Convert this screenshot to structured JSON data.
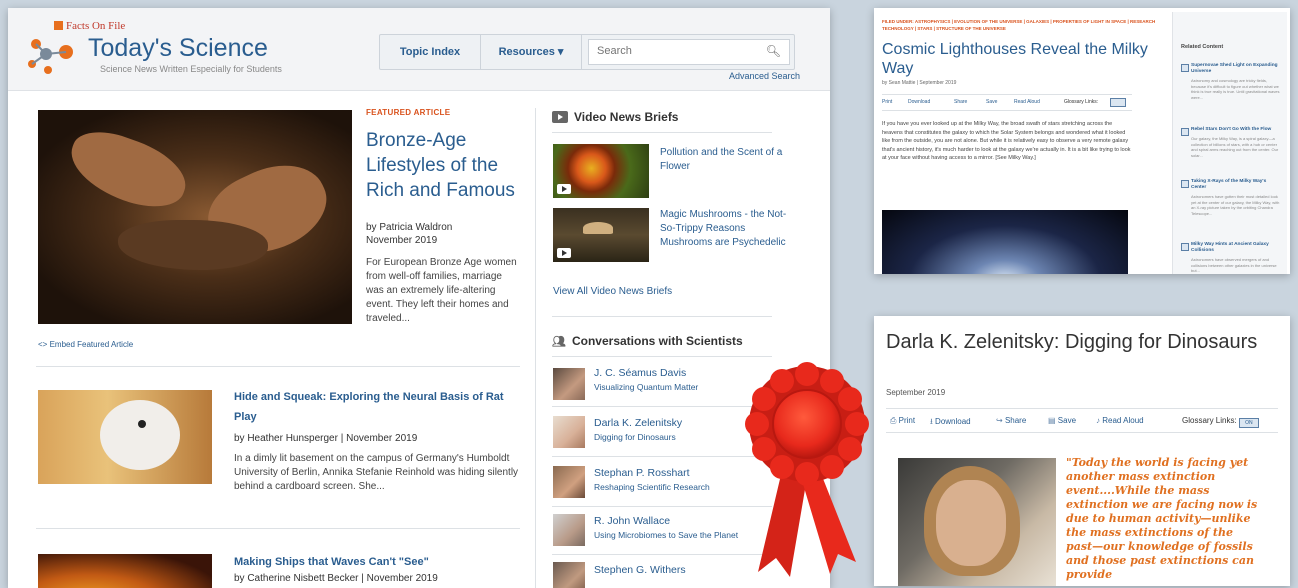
{
  "header": {
    "brand_top": "Facts On File",
    "brand_name": "Today's Science",
    "tagline": "Science News Written Especially for Students",
    "nav": [
      "Topic Index",
      "Resources ▾"
    ],
    "search_placeholder": "Search",
    "advanced_search": "Advanced Search"
  },
  "featured": {
    "label": "FEATURED ARTICLE",
    "title": "Bronze-Age Lifestyles of the Rich and Famous",
    "author": "by Patricia Waldron",
    "date": "November 2019",
    "excerpt": "For European Bronze Age women from well-off families, marriage was an extremely life-altering event. They left their homes and traveled...",
    "embed": "<> Embed Featured Article"
  },
  "articles": [
    {
      "title": "Hide and Squeak: Exploring the Neural Basis of Rat Play",
      "byline": "by Heather Hunsperger | November 2019",
      "excerpt": "In a dimly lit basement on the campus of Germany's Humboldt University of Berlin, Annika Stefanie Reinhold was hiding silently behind a cardboard screen. She..."
    },
    {
      "title": "Making Ships that Waves Can't \"See\"",
      "byline": "by Catherine Nisbett Becker | November 2019"
    }
  ],
  "video_briefs": {
    "heading": "Video News Briefs",
    "items": [
      "Pollution and the Scent of a Flower",
      "Magic Mushrooms - the Not-So-Trippy Reasons Mushrooms are Psychedelic"
    ],
    "view_all": "View All Video News Briefs"
  },
  "conversations": {
    "heading": "Conversations with Scientists",
    "items": [
      {
        "name": "J. C. Séamus Davis",
        "topic": "Visualizing Quantum Matter"
      },
      {
        "name": "Darla K. Zelenitsky",
        "topic": "Digging for Dinosaurs"
      },
      {
        "name": "Stephan P. Rosshart",
        "topic": "Reshaping Scientific Research"
      },
      {
        "name": "R. John Wallace",
        "topic": "Using Microbiomes to Save the Planet"
      },
      {
        "name": "Stephen G. Withers",
        "topic": ""
      }
    ]
  },
  "cosmic": {
    "filed": "FILED UNDER: ASTROPHYSICS | EVOLUTION OF THE UNIVERSE | GALAXIES | PROPERTIES OF LIGHT IN SPACE | RESEARCH TECHNOLOGY | STARS | STRUCTURE OF THE UNIVERSE",
    "title": "Cosmic Lighthouses Reveal the Milky Way",
    "meta": "by Sean Mattie | September 2019",
    "tools": [
      "Print",
      "Download",
      "Share",
      "Save",
      "Read Aloud",
      "Glossary Links:"
    ],
    "body": "If you have you ever looked up at the Milky Way, the broad swath of stars stretching across the heavens that constitutes the galaxy to which the Solar System belongs and wondered what it looked like from the outside, you are not alone. But while it is relatively easy to observe a very remote galaxy that's ancient history, it's much harder to look at the galaxy we're actually in. It is a bit like trying to look at your face without having access to a mirror. [See Milky Way.]",
    "related_heading": "Related Content",
    "related": [
      {
        "title": "Supernovae Shed Light on Expanding Universe",
        "desc": "Astronomy and cosmology are tricky fields, because it's difficult to figure out whether what we think is true really is true. Until gravitational waves were..."
      },
      {
        "title": "Rebel Stars Don't Go With the Flow",
        "desc": "Our galaxy, the Milky Way, is a spiral galaxy—a collection of billions of stars, with a hub or center and spiral arms reaching out from the center. Our solar..."
      },
      {
        "title": "Taking X-Rays of the Milky Way's Center",
        "desc": "Astronomers have gotten their most detailed look yet at the center of our galaxy, the Milky Way, with an X-ray picture taken by the orbiting Chandra Telescope..."
      },
      {
        "title": "Milky Way Hints at Ancient Galaxy Collisions",
        "desc": "Astronomers have observed mergers of and collisions between other galaxies in the universe but..."
      }
    ]
  },
  "interview": {
    "title": "Darla K. Zelenitsky: Digging for Dinosaurs",
    "date": "September 2019",
    "tools": [
      "Print",
      "Download",
      "Share",
      "Save",
      "Read Aloud",
      "Glossary Links:"
    ],
    "toggle": "ON",
    "quote": "\"Today the world is facing yet another mass extinction event....While the mass extinction we are facing now is due to human activity—unlike the mass extinctions of the past—our knowledge of fossils and those past extinctions can provide"
  },
  "colors": {
    "link": "#2a5d8f",
    "accent": "#d9531e",
    "ribbon": "#e8291c"
  }
}
